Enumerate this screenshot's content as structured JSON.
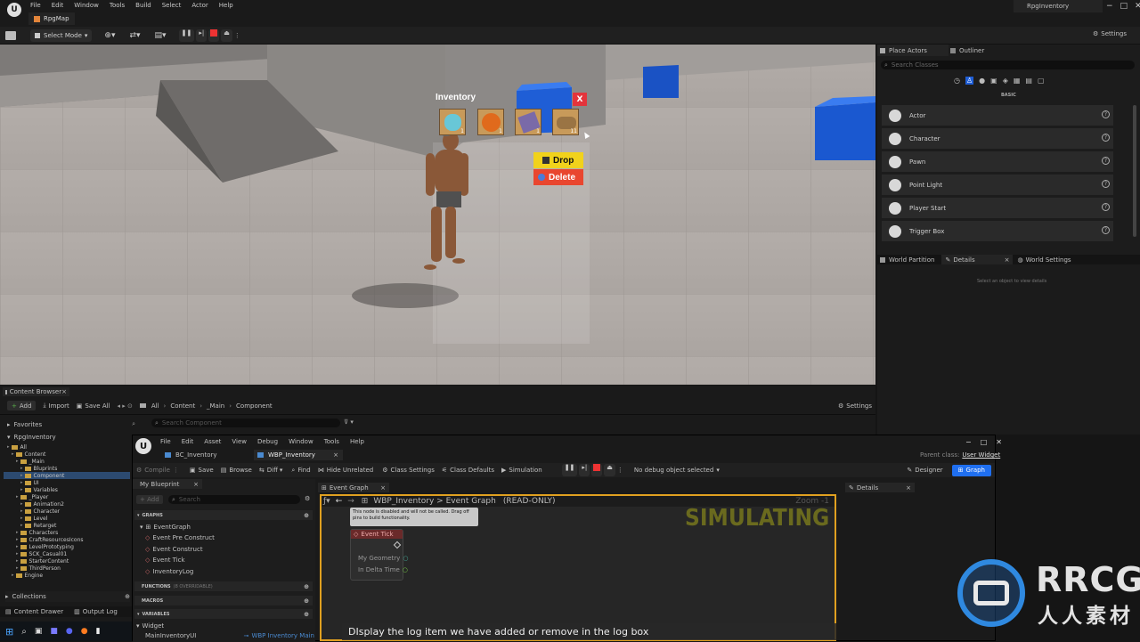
{
  "app": {
    "menu": [
      "File",
      "Edit",
      "Window",
      "Tools",
      "Build",
      "Select",
      "Actor",
      "Help"
    ],
    "level_tab": "RpgMap",
    "project_name": "RpgInventory",
    "window_controls": [
      "−",
      "□",
      "✕"
    ]
  },
  "toolbar": {
    "select_mode": "Select Mode",
    "settings": "Settings"
  },
  "viewport": {
    "inventory_title": "Inventory",
    "close_label": "X",
    "slots": [
      {
        "icon": "gem-icon",
        "count": "1"
      },
      {
        "icon": "orb-icon",
        "count": "1"
      },
      {
        "icon": "scroll-icon",
        "count": "1"
      },
      {
        "icon": "log-icon",
        "count": "11"
      }
    ],
    "drop_label": "Drop",
    "delete_label": "Delete"
  },
  "place_actors": {
    "tab": "Place Actors",
    "outliner_tab": "Outliner",
    "search_placeholder": "Search Classes",
    "section": "BASIC",
    "items": [
      "Actor",
      "Character",
      "Pawn",
      "Point Light",
      "Player Start",
      "Trigger Box"
    ]
  },
  "details_tabs": {
    "world_partition": "World Partition",
    "details": "Details",
    "world_settings": "World Settings",
    "empty_hint": "Select an object to view details"
  },
  "content_browser": {
    "tab": "Content Browser",
    "add": "Add",
    "import": "Import",
    "save_all": "Save All",
    "path": [
      "All",
      "Content",
      "_Main",
      "Component"
    ],
    "settings": "Settings",
    "favorites": "Favorites",
    "search_placeholder": "Search Component",
    "project": "RpgInventory",
    "tree": [
      {
        "label": "All",
        "level": 0
      },
      {
        "label": "Content",
        "level": 1
      },
      {
        "label": "_Main",
        "level": 2
      },
      {
        "label": "Bluprints",
        "level": 3
      },
      {
        "label": "Component",
        "level": 3,
        "selected": true
      },
      {
        "label": "UI",
        "level": 3
      },
      {
        "label": "Variables",
        "level": 3
      },
      {
        "label": "_Player",
        "level": 2
      },
      {
        "label": "Animation2",
        "level": 3
      },
      {
        "label": "Character",
        "level": 3
      },
      {
        "label": "Level",
        "level": 3
      },
      {
        "label": "Retarget",
        "level": 3
      },
      {
        "label": "Characters",
        "level": 2
      },
      {
        "label": "CraftResourcesIcons",
        "level": 2
      },
      {
        "label": "LevelPrototyping",
        "level": 2
      },
      {
        "label": "SCK_Casual01",
        "level": 2
      },
      {
        "label": "StarterContent",
        "level": 2
      },
      {
        "label": "ThirdPerson",
        "level": 2
      },
      {
        "label": "Engine",
        "level": 1
      }
    ],
    "collections": "Collections",
    "content_drawer": "Content Drawer",
    "output_log": "Output Log"
  },
  "blueprint": {
    "menu": [
      "File",
      "Edit",
      "Asset",
      "View",
      "Debug",
      "Window",
      "Tools",
      "Help"
    ],
    "tabs": [
      "BC_Inventory",
      "WBP_Inventory"
    ],
    "parent_class_label": "Parent class:",
    "parent_class": "User Widget",
    "toolbar": [
      "Compile",
      "Save",
      "Browse",
      "Diff",
      "Find",
      "Hide Unrelated",
      "Class Settings",
      "Class Defaults",
      "Simulation"
    ],
    "debug_select": "No debug object selected",
    "designer": "Designer",
    "graph": "Graph",
    "my_blueprint": "My Blueprint",
    "add": "+ Add",
    "search": "Search",
    "graphs_header": "GRAPHS",
    "event_graph": "EventGraph",
    "events": [
      "Event Pre Construct",
      "Event Construct",
      "Event Tick",
      "InventoryLog"
    ],
    "functions_header": "FUNCTIONS",
    "functions_hint": "(8 OVERRIDABLE)",
    "macros_header": "MACROS",
    "variables_header": "VARIABLES",
    "widget_group": "Widget",
    "var_name": "MainInventoryUI",
    "var_type": "WBP Inventory Main",
    "graph_tab": "Event Graph",
    "details_tab": "Details",
    "breadcrumb": "WBP_Inventory > Event Graph",
    "read_only": "(READ-ONLY)",
    "simulating": "SIMULATING",
    "zoom": "Zoom -1",
    "disabled_note": "This node is disabled and will not be called. Drag off pins to build functionality.",
    "node_title": "Event Tick",
    "node_pins": [
      "My Geometry",
      "In Delta Time"
    ]
  },
  "caption": "DIsplay the log item we have added or remove in the log box",
  "watermark": {
    "brand": "RRCG",
    "sub": "人人素材"
  }
}
